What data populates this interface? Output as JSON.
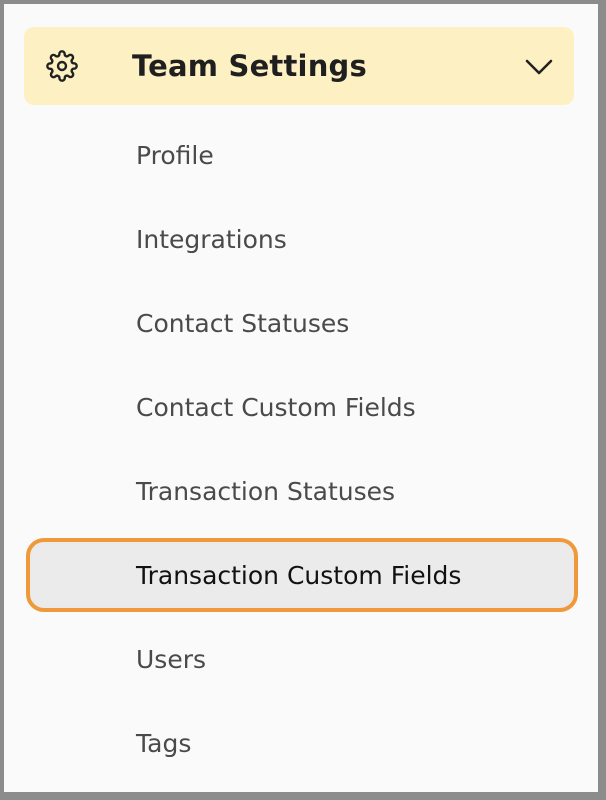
{
  "header": {
    "title": "Team Settings",
    "icon": "gear-icon",
    "expand_icon": "chevron-down-icon",
    "background_color": "#fdf1c4"
  },
  "menu": {
    "items": [
      {
        "label": "Profile",
        "active": false
      },
      {
        "label": "Integrations",
        "active": false
      },
      {
        "label": "Contact Statuses",
        "active": false
      },
      {
        "label": "Contact Custom Fields",
        "active": false
      },
      {
        "label": "Transaction Statuses",
        "active": false
      },
      {
        "label": "Transaction Custom Fields",
        "active": true
      },
      {
        "label": "Users",
        "active": false
      },
      {
        "label": "Tags",
        "active": false
      }
    ],
    "highlight_color": "#f0993a"
  }
}
